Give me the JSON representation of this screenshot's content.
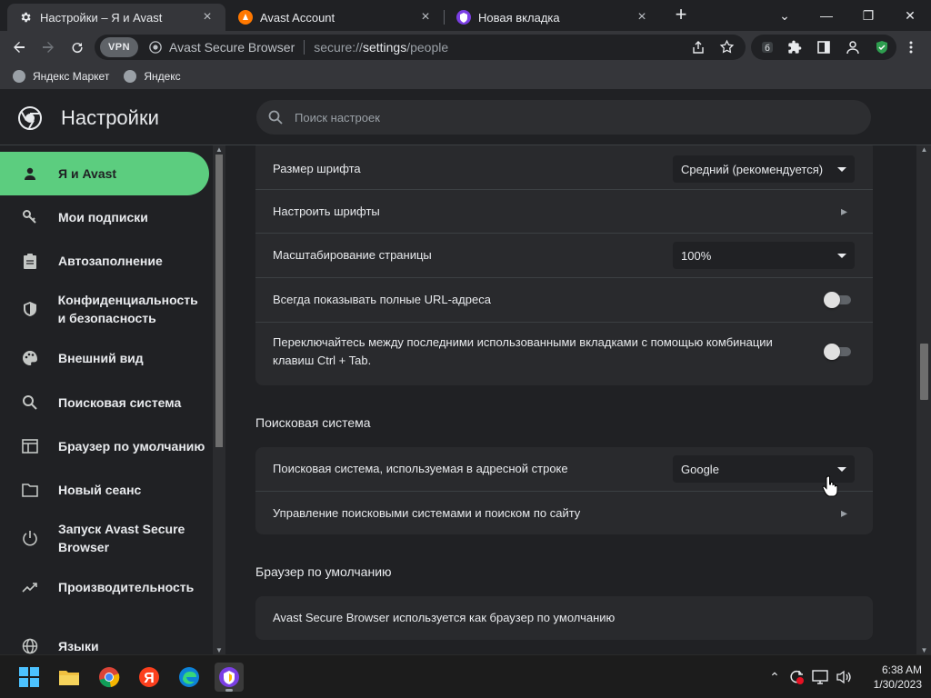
{
  "browser": {
    "tabs": [
      {
        "title": "Настройки – Я и Avast",
        "icon": "gear-icon",
        "active": true
      },
      {
        "title": "Avast Account",
        "icon": "avast-logo-icon",
        "active": false
      },
      {
        "title": "Новая вкладка",
        "icon": "avast-browser-icon",
        "active": false
      }
    ],
    "new_tab_label": "+",
    "vpn_label": "VPN",
    "site_name": "Avast Secure Browser",
    "url_scheme": "secure://",
    "url_host": "settings",
    "url_path": "/people",
    "bookmarks": [
      {
        "label": "Яндекс Маркет"
      },
      {
        "label": "Яндекс"
      }
    ]
  },
  "settings": {
    "title": "Настройки",
    "search_placeholder": "Поиск настроек"
  },
  "sidebar": {
    "items": [
      {
        "label": "Я и Avast",
        "icon": "person-icon",
        "active": true
      },
      {
        "label": "Мои подписки",
        "icon": "key-icon"
      },
      {
        "label": "Автозаполнение",
        "icon": "clipboard-icon"
      },
      {
        "label": "Конфиденциальность и безопасность",
        "icon": "shield-icon"
      },
      {
        "label": "Внешний вид",
        "icon": "palette-icon"
      },
      {
        "label": "Поисковая система",
        "icon": "search-icon"
      },
      {
        "label": "Браузер по умолчанию",
        "icon": "browser-window-icon"
      },
      {
        "label": "Новый сеанс",
        "icon": "folder-icon"
      },
      {
        "label": "Запуск Avast Secure Browser",
        "icon": "power-icon"
      },
      {
        "label": "Производительность",
        "icon": "trending-icon"
      },
      {
        "label": "Языки",
        "icon": "globe-icon"
      }
    ]
  },
  "main": {
    "appearance_rows": {
      "font_size_label": "Размер шрифта",
      "font_size_value": "Средний (рекомендуется)",
      "customize_fonts_label": "Настроить шрифты",
      "page_zoom_label": "Масштабирование страницы",
      "page_zoom_value": "100%",
      "full_urls_label": "Всегда показывать полные URL-адреса",
      "full_urls_on": false,
      "ctrl_tab_label": "Переключайтесь между последними использованными вкладками с помощью комбинации клавиш Ctrl + Tab.",
      "ctrl_tab_on": false
    },
    "search_section": {
      "title": "Поисковая система",
      "engine_label": "Поисковая система, используемая в адресной строке",
      "engine_value": "Google",
      "manage_label": "Управление поисковыми системами и поиском по сайту"
    },
    "default_browser_section": {
      "title": "Браузер по умолчанию",
      "status_text": "Avast Secure Browser используется как браузер по умолчанию"
    }
  },
  "taskbar": {
    "time": "6:38 AM",
    "date": "1/30/2023",
    "apps": [
      "windows-start-icon",
      "file-explorer-icon",
      "chrome-icon",
      "yandex-icon",
      "edge-icon",
      "avast-browser-icon"
    ]
  },
  "colors": {
    "accent_green": "#5ccd7f",
    "background": "#202124",
    "card": "#292a2d"
  }
}
